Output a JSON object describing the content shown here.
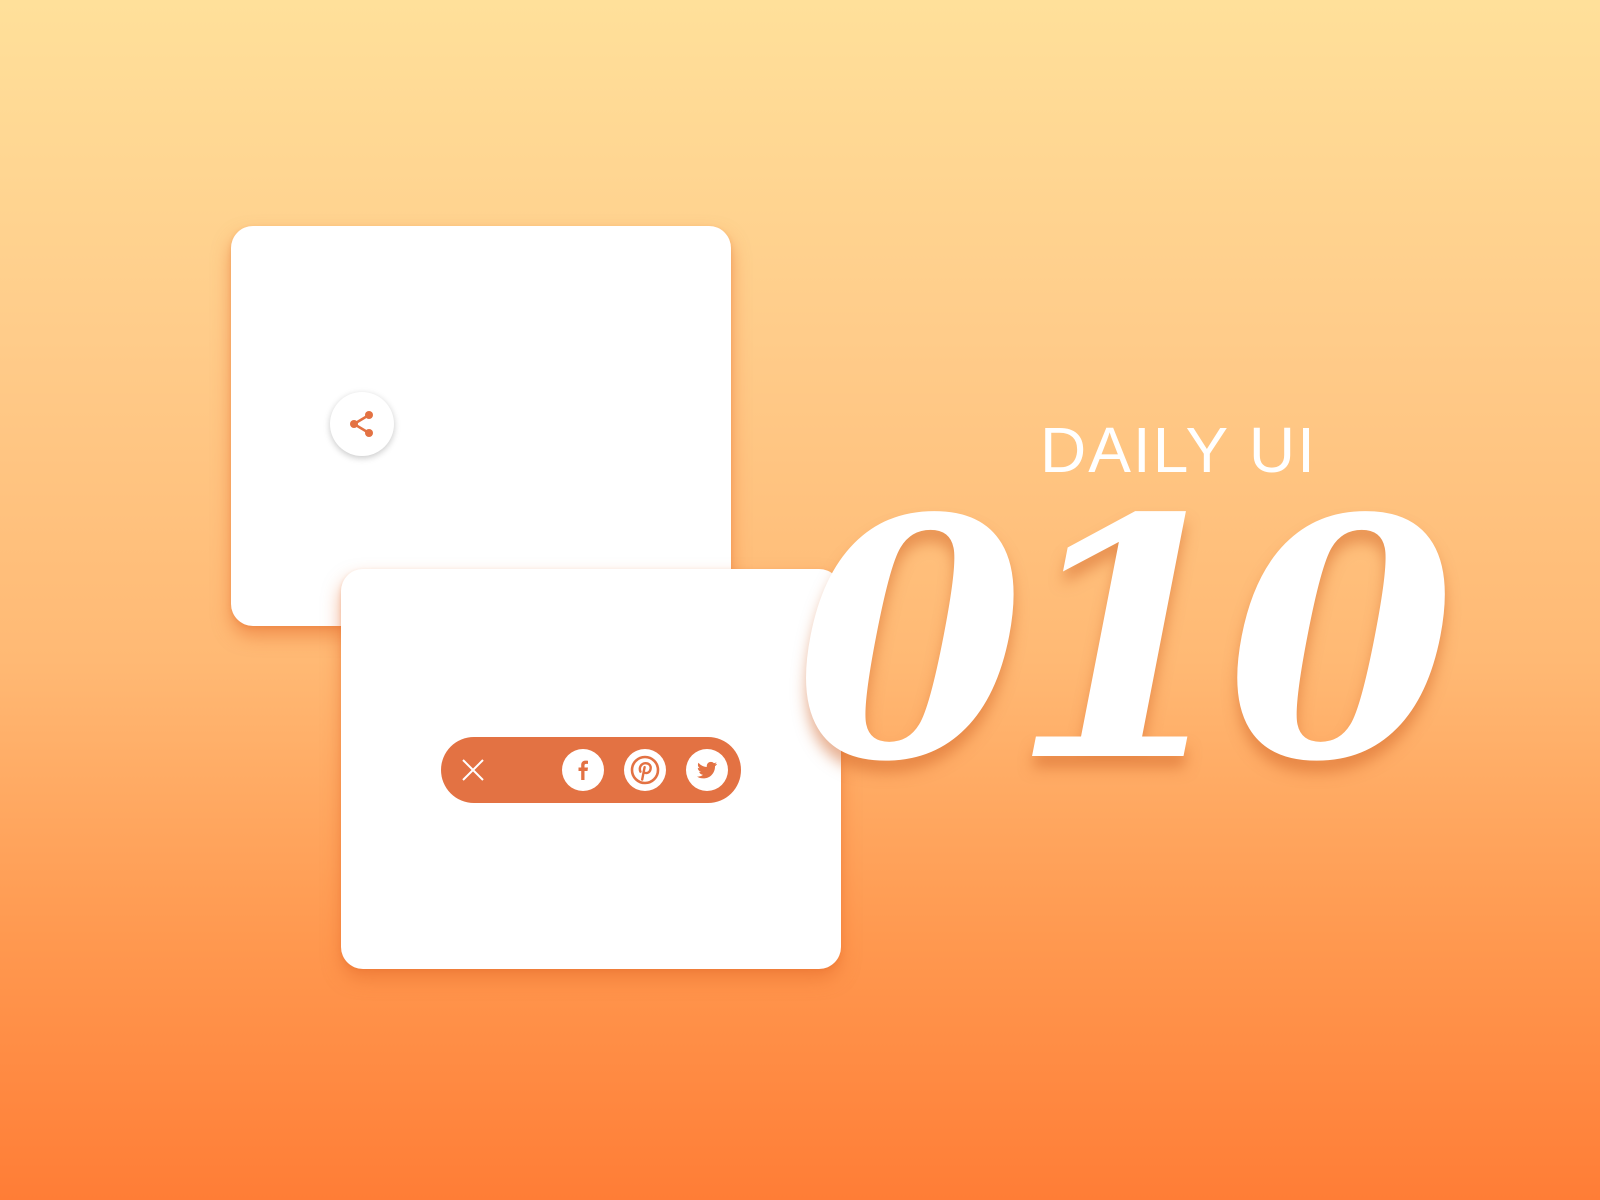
{
  "colors": {
    "background_top": "#FFE09A",
    "background_bottom": "#FF7D36",
    "accent": "#E37243",
    "card": "#ffffff"
  },
  "card_collapsed": {
    "share_button": {
      "icon": "share-icon"
    }
  },
  "card_expanded": {
    "share_bar": {
      "close_icon": "close-icon",
      "social_buttons": [
        {
          "network": "facebook",
          "icon": "facebook-icon"
        },
        {
          "network": "pinterest",
          "icon": "pinterest-icon"
        },
        {
          "network": "twitter",
          "icon": "twitter-icon"
        }
      ]
    }
  },
  "title": {
    "label": "DAILY UI",
    "number": "010"
  }
}
